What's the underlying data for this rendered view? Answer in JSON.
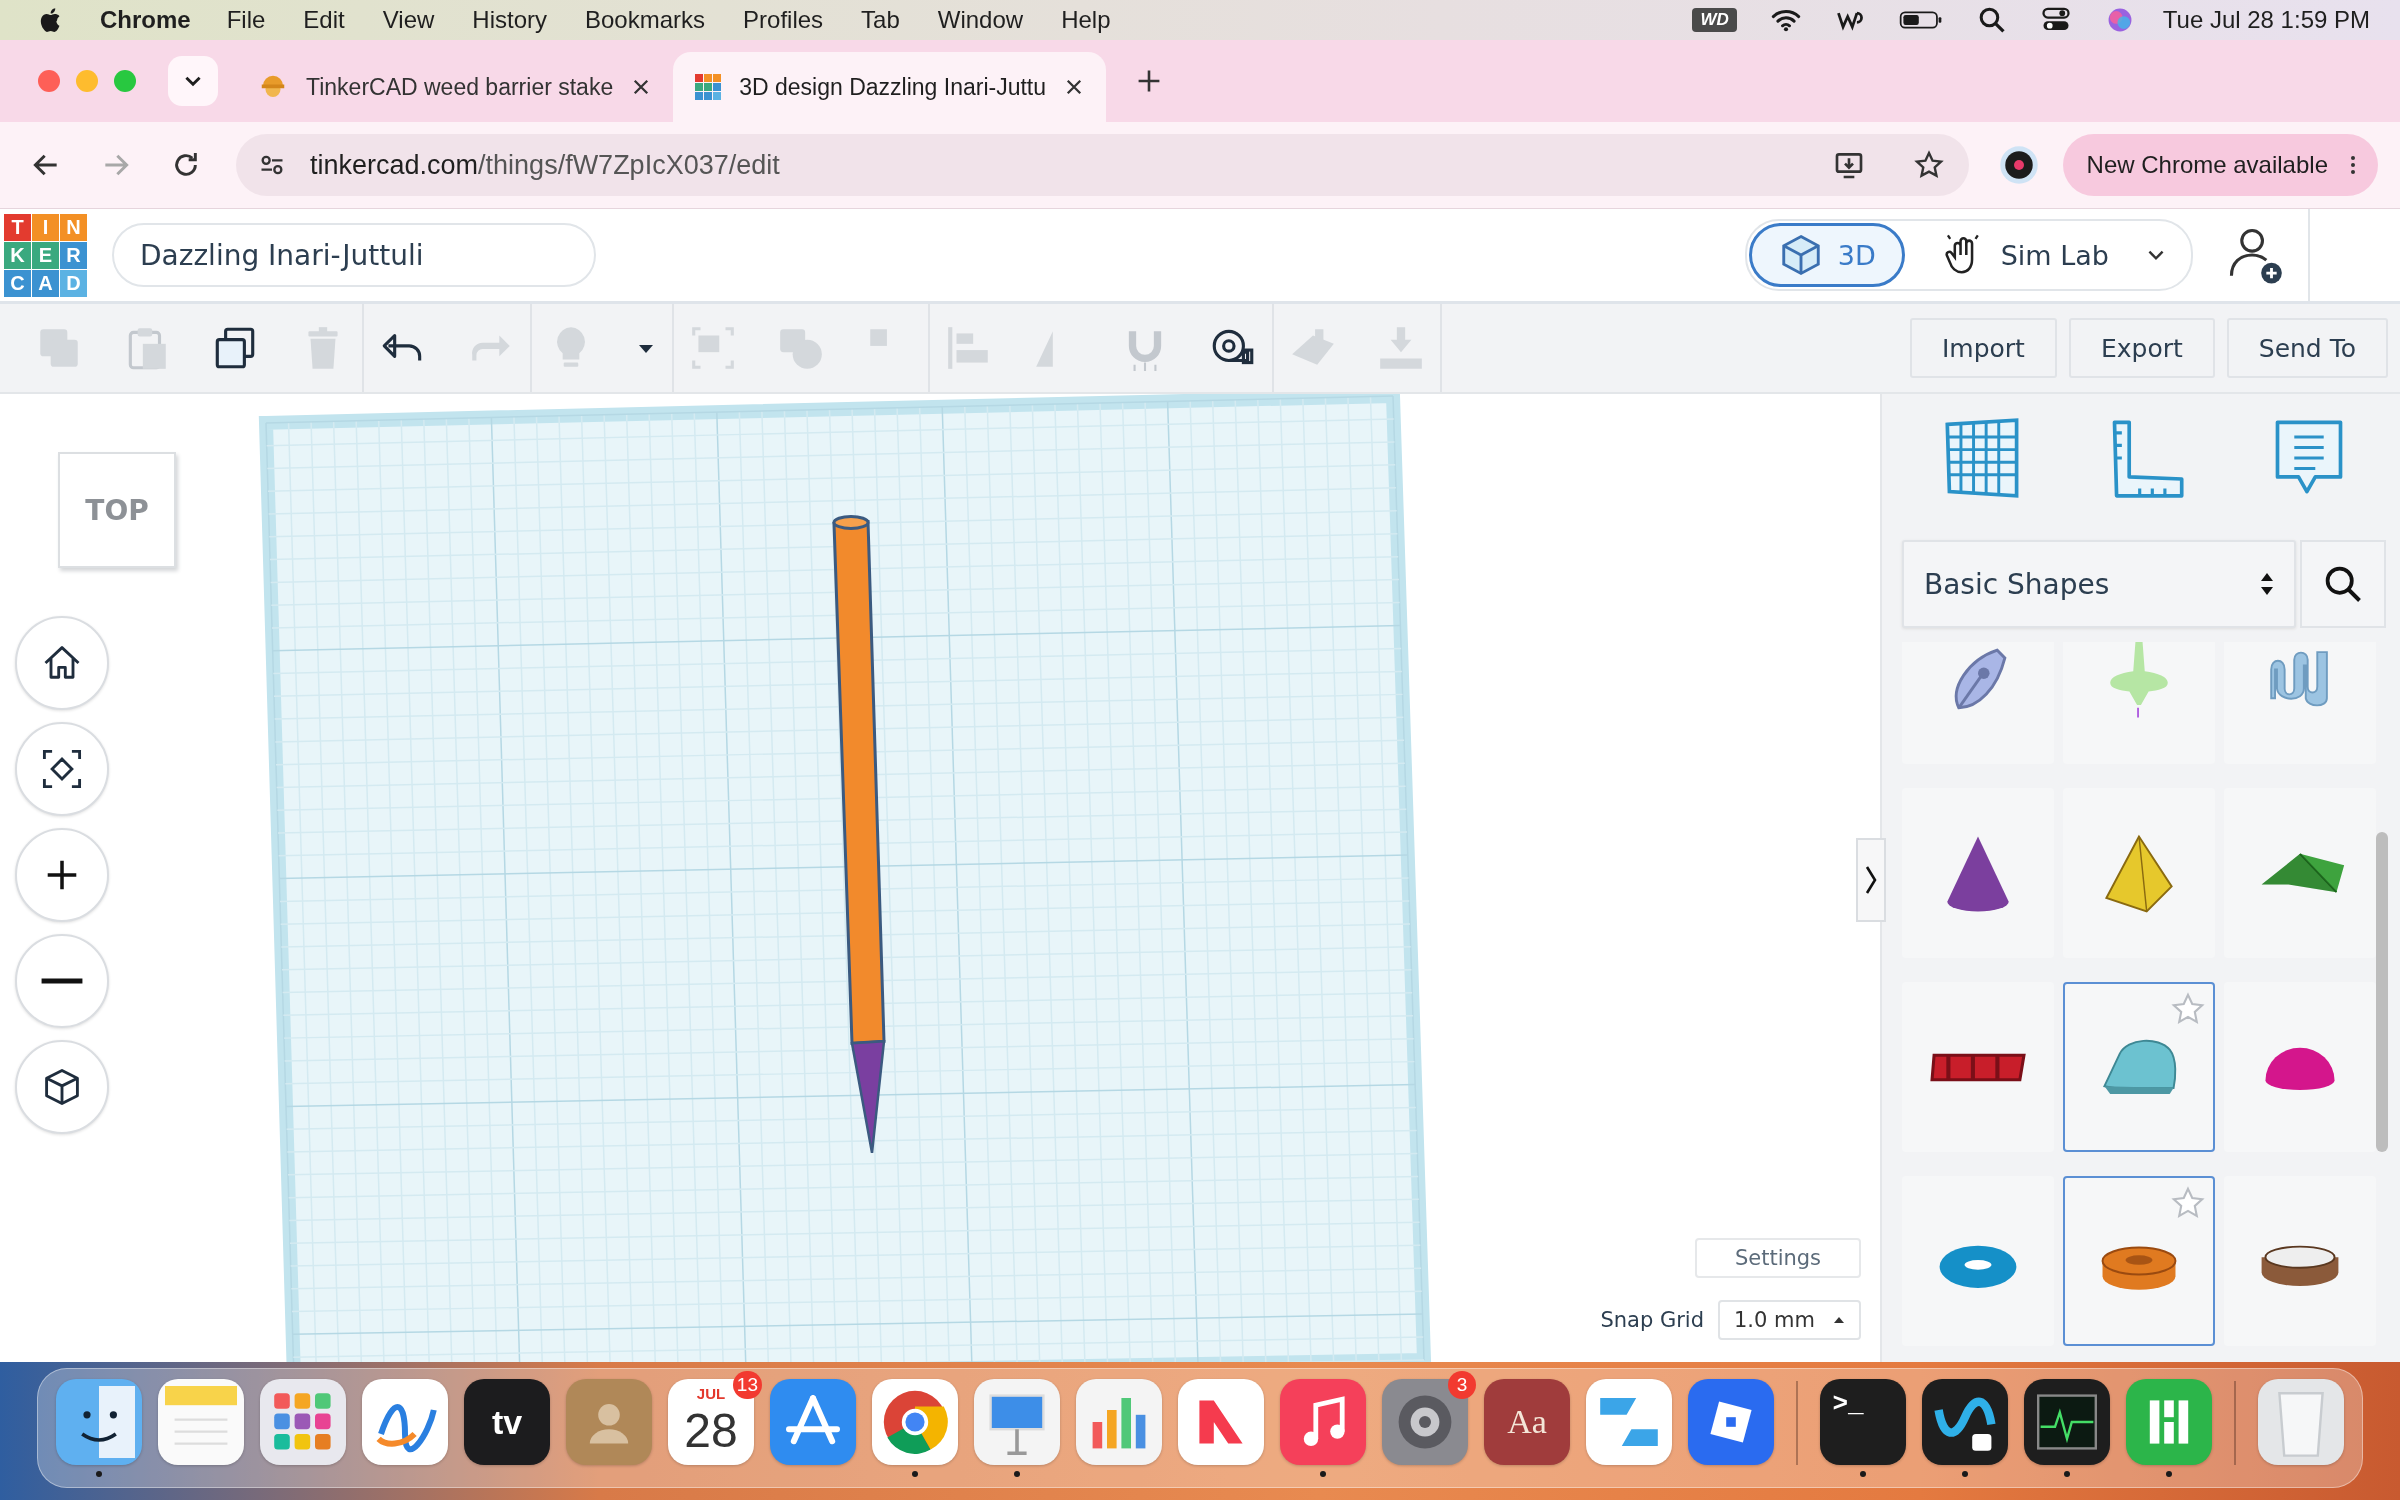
{
  "menubar": {
    "app": "Chrome",
    "menus": [
      "File",
      "Edit",
      "View",
      "History",
      "Bookmarks",
      "Profiles",
      "Tab",
      "Window",
      "Help"
    ],
    "status_badge": "WD",
    "clock": "Tue Jul 28  1:59 PM"
  },
  "tabs": [
    {
      "title": "TinkerCAD weed barrier stake",
      "selected": false
    },
    {
      "title": "3D design Dazzling Inari-Juttu",
      "selected": true
    }
  ],
  "address": {
    "host": "tinkercad.com",
    "path": "/things/fW7ZpIcX037/edit"
  },
  "update_button": "New Chrome available",
  "logo_letters": [
    "T",
    "I",
    "N",
    "K",
    "E",
    "R",
    "C",
    "A",
    "D"
  ],
  "design_name": "Dazzling Inari-Juttuli",
  "modes": [
    {
      "label": "3D",
      "selected": true
    },
    {
      "label": "Sim Lab",
      "selected": false
    }
  ],
  "tool_groups": [
    [
      {
        "kind": "copy",
        "disabled": true
      },
      {
        "kind": "paste",
        "disabled": true
      },
      {
        "kind": "duplicate",
        "disabled": false
      },
      {
        "kind": "delete",
        "disabled": true
      }
    ],
    [
      {
        "kind": "undo",
        "disabled": false
      },
      {
        "kind": "redo",
        "disabled": true
      }
    ],
    [
      {
        "kind": "lightbulb",
        "disabled": true
      },
      {
        "kind": "caret",
        "disabled": false
      }
    ],
    [
      {
        "kind": "group",
        "disabled": true
      },
      {
        "kind": "union",
        "disabled": true
      },
      {
        "kind": "ungroup",
        "disabled": true
      }
    ],
    [
      {
        "kind": "align",
        "disabled": true
      },
      {
        "kind": "mirror",
        "disabled": true
      },
      {
        "kind": "magnet",
        "disabled": true
      },
      {
        "kind": "ruler",
        "disabled": false
      }
    ],
    [
      {
        "kind": "workplane",
        "disabled": true
      },
      {
        "kind": "drop",
        "disabled": true
      }
    ]
  ],
  "actions": [
    "Import",
    "Export",
    "Send To"
  ],
  "view_cube": "TOP",
  "nav_buttons": [
    {
      "kind": "home"
    },
    {
      "kind": "fit"
    },
    {
      "kind": "zoom-in"
    },
    {
      "kind": "zoom-out"
    },
    {
      "kind": "perspective"
    }
  ],
  "settings_button": "Settings",
  "snap_grid": {
    "label": "Snap Grid",
    "value": "1.0 mm"
  },
  "shapes_panel": {
    "category": "Basic Shapes",
    "shapes": [
      {
        "kind": "pen-nib",
        "color": "#a9b6e6",
        "selected": false
      },
      {
        "kind": "spinning-top",
        "color": "#b6e6a4",
        "selected": false
      },
      {
        "kind": "scribble",
        "color": "#9cc4e2",
        "selected": false
      },
      {
        "kind": "cone",
        "color": "#7b3f9e",
        "selected": false
      },
      {
        "kind": "pyramid",
        "color": "#e6c82c",
        "selected": false
      },
      {
        "kind": "roof",
        "color": "#3ea33e",
        "selected": false
      },
      {
        "kind": "text-3d",
        "color": "#c81e2a",
        "selected": false
      },
      {
        "kind": "half-cylinder",
        "color": "#6cc2d0",
        "selected": true
      },
      {
        "kind": "hemisphere",
        "color": "#d4168c",
        "selected": false
      },
      {
        "kind": "torus",
        "color": "#1590c8",
        "selected": false
      },
      {
        "kind": "tube",
        "color": "#e07a20",
        "selected": true
      },
      {
        "kind": "ring",
        "color": "#8b5a3a",
        "selected": false
      }
    ]
  },
  "dock": [
    {
      "kind": "finder",
      "running": true
    },
    {
      "kind": "notes",
      "running": false
    },
    {
      "kind": "launchpad",
      "running": false
    },
    {
      "kind": "freeform",
      "running": false
    },
    {
      "kind": "tv",
      "label": "tv",
      "running": false
    },
    {
      "kind": "contacts",
      "running": false
    },
    {
      "kind": "calendar",
      "month": "JUL",
      "day": "28",
      "badge": "13",
      "running": false
    },
    {
      "kind": "appstore",
      "running": false
    },
    {
      "kind": "chrome",
      "running": true
    },
    {
      "kind": "keynote",
      "running": true
    },
    {
      "kind": "numbers-chart",
      "running": false
    },
    {
      "kind": "news",
      "running": false
    },
    {
      "kind": "music",
      "running": true
    },
    {
      "kind": "settings",
      "badge": "3",
      "running": false
    },
    {
      "kind": "dictionary",
      "label": "Aa",
      "running": false
    },
    {
      "kind": "blocks",
      "running": false
    },
    {
      "kind": "roblox",
      "running": false
    },
    {
      "kind": "separator"
    },
    {
      "kind": "terminal",
      "label": ">_",
      "running": true
    },
    {
      "kind": "webex",
      "running": true
    },
    {
      "kind": "activity",
      "running": true
    },
    {
      "kind": "numbers",
      "running": true
    },
    {
      "kind": "separator"
    },
    {
      "kind": "trash",
      "running": false
    }
  ]
}
